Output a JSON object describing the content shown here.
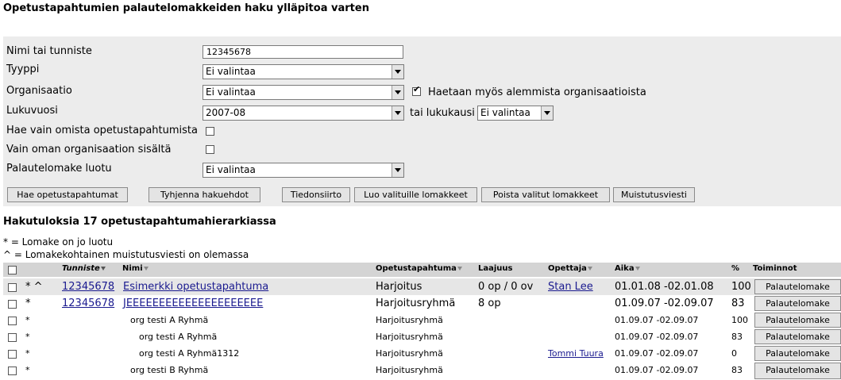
{
  "page_title": "Opetustapahtumien palautelomakkeiden haku ylläpitoa varten",
  "search": {
    "name_label": "Nimi tai tunniste",
    "name_value": "12345678",
    "type_label": "Tyyppi",
    "type_value": "Ei valintaa",
    "org_label": "Organisaatio",
    "org_value": "Ei valintaa",
    "suborg_checked": true,
    "suborg_label": "Haetaan myös alemmista organisaatioista",
    "year_label": "Lukuvuosi",
    "year_value": "2007-08",
    "period_label": "tai lukukausi",
    "period_value": "Ei valintaa",
    "own_label": "Hae vain omista opetustapahtumista",
    "own_checked": false,
    "orgonly_label": "Vain oman organisaation sisältä",
    "orgonly_checked": false,
    "created_label": "Palautelomake luotu",
    "created_value": "Ei valintaa"
  },
  "buttons": {
    "search": "Hae opetustapahtumat",
    "clear": "Tyhjenna hakuehdot",
    "transfer": "Tiedonsiirto",
    "create": "Luo valituille lomakkeet",
    "delete": "Poista valitut lomakkeet",
    "reminder": "Muistutusviesti"
  },
  "results": {
    "title": "Hakutuloksia 17 opetustapahtumahierarkiassa",
    "legend_1": "* = Lomake on jo luotu",
    "legend_2": "^ = Lomakekohtainen muistutusviesti on olemassa",
    "headers": {
      "tunniste": "Tunniste",
      "nimi": "Nimi",
      "opetustapahtuma": "Opetustapahtuma",
      "laajuus": "Laajuus",
      "opettaja": "Opettaja",
      "aika": "Aika",
      "percent": "%",
      "toiminnot": "Toiminnot"
    },
    "rows": [
      {
        "marks": "* ^",
        "tunniste": "12345678",
        "nimi": "Esimerkki opetustapahtuma ",
        "type": "Harjoitus",
        "laajuus": "0 op / 0 ov",
        "opettaja": "Stan Lee",
        "aika": "01.01.08 -02.01.08",
        "pct": "100",
        "action": "Palautelomake"
      },
      {
        "marks": "*",
        "tunniste": "12345678",
        "nimi": "JEEEEEEEEEEEEEEEEEEEEE ",
        "type": "Harjoitusryhmä",
        "laajuus": "8 op",
        "opettaja": "",
        "aika": "01.09.07 -02.09.07",
        "pct": "83",
        "action": "Palautelomake"
      },
      {
        "marks": "*",
        "tunniste": "",
        "nimi": "org testi A Ryhmä",
        "type": "Harjoitusryhmä",
        "laajuus": "",
        "opettaja": "",
        "aika": "01.09.07 -02.09.07",
        "pct": "100",
        "action": "Palautelomake"
      },
      {
        "marks": "*",
        "tunniste": "",
        "nimi": "org testi A Ryhmä",
        "type": "Harjoitusryhmä",
        "laajuus": "",
        "opettaja": "",
        "aika": "01.09.07 -02.09.07",
        "pct": "83",
        "action": "Palautelomake"
      },
      {
        "marks": "*",
        "tunniste": "",
        "nimi": "org testi A Ryhmä1312",
        "type": "Harjoitusryhmä",
        "laajuus": "",
        "opettaja": "Tommi Tuura",
        "aika": "01.09.07 -02.09.07",
        "pct": "0",
        "action": "Palautelomake"
      },
      {
        "marks": "*",
        "tunniste": "",
        "nimi": "org testi B Ryhmä",
        "type": "Harjoitusryhmä",
        "laajuus": "",
        "opettaja": "",
        "aika": "01.09.07 -02.09.07",
        "pct": "83",
        "action": "Palautelomake"
      }
    ]
  }
}
